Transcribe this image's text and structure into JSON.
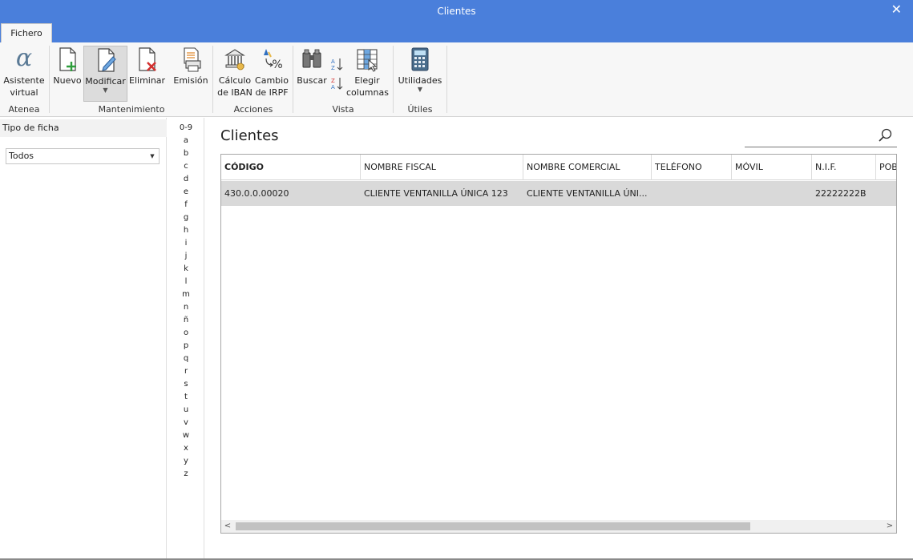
{
  "window": {
    "title": "Clientes",
    "close_label": "✕"
  },
  "tabs": [
    {
      "label": "Fichero"
    }
  ],
  "ribbon": {
    "groups": [
      {
        "label": "Atenea"
      },
      {
        "label": "Mantenimiento"
      },
      {
        "label": "Acciones"
      },
      {
        "label": "Vista"
      },
      {
        "label": "Útiles"
      }
    ],
    "buttons": {
      "asistente": [
        "Asistente",
        "virtual"
      ],
      "nuevo": "Nuevo",
      "modificar": "Modificar",
      "eliminar": "Eliminar",
      "emision": "Emisión",
      "calculo_iban": [
        "Cálculo",
        "de IBAN"
      ],
      "cambio_irpf": [
        "Cambio",
        "de IRPF"
      ],
      "buscar": "Buscar",
      "elegir_columnas": [
        "Elegir",
        "columnas"
      ],
      "utilidades": "Utilidades"
    }
  },
  "left_panel": {
    "header": "Tipo de ficha",
    "select_value": "Todos"
  },
  "alphabet": [
    "0-9",
    "a",
    "b",
    "c",
    "d",
    "e",
    "f",
    "g",
    "h",
    "i",
    "j",
    "k",
    "l",
    "m",
    "n",
    "ñ",
    "o",
    "p",
    "q",
    "r",
    "s",
    "t",
    "u",
    "v",
    "w",
    "x",
    "y",
    "z"
  ],
  "main": {
    "title": "Clientes",
    "columns": [
      "CÓDIGO",
      "NOMBRE FISCAL",
      "NOMBRE COMERCIAL",
      "TELÉFONO",
      "MÓVIL",
      "N.I.F.",
      "POB"
    ],
    "rows": [
      [
        "430.0.0.00020",
        "CLIENTE VENTANILLA ÚNICA 123",
        "CLIENTE VENTANILLA ÚNI...",
        "",
        "",
        "22222222B",
        ""
      ]
    ]
  },
  "icons": {
    "close": "close-icon",
    "search": "search-icon"
  }
}
